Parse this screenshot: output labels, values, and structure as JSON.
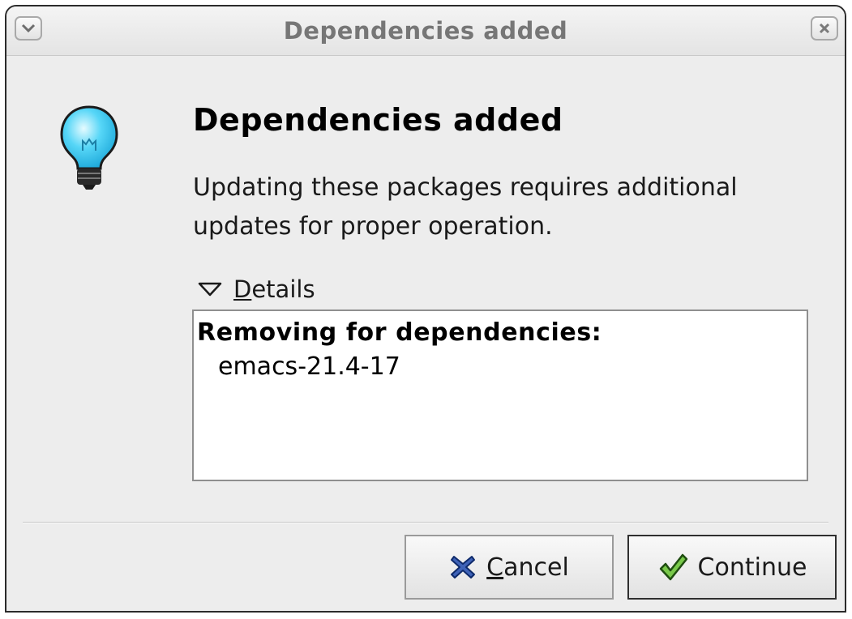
{
  "window": {
    "title": "Dependencies added"
  },
  "dialog": {
    "icon": "lightbulb-icon",
    "heading": "Dependencies added",
    "message": "Updating these packages requires additional updates for proper operation.",
    "details": {
      "mnemonic": "D",
      "label_rest": "etails",
      "expanded": true,
      "section_header": "Removing for dependencies:",
      "items": [
        "emacs-21.4-17"
      ]
    }
  },
  "buttons": {
    "cancel": {
      "mnemonic": "C",
      "label_rest": "ancel",
      "icon": "cancel-x-icon"
    },
    "continue": {
      "label": "Continue",
      "icon": "checkmark-icon"
    }
  },
  "colors": {
    "window_bg": "#ededed",
    "title_text": "#767676",
    "bulb": "#38c7f4"
  }
}
